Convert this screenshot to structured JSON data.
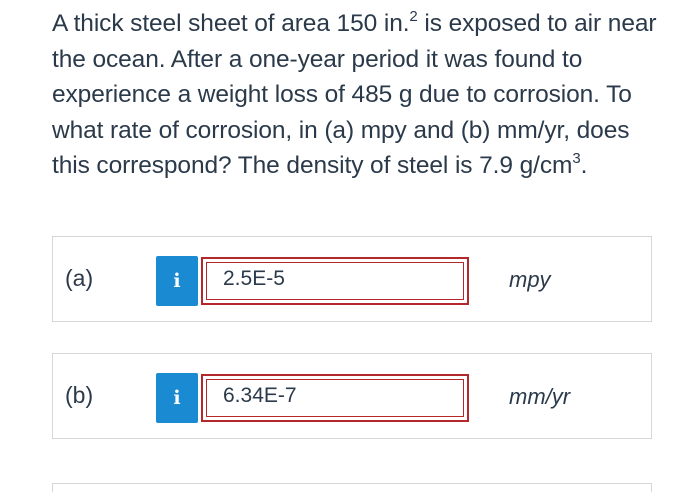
{
  "question": {
    "text_before_sup1": "A thick steel sheet of area 150 in.",
    "sup1": "2",
    "text_middle": " is exposed to air near the ocean. After a one-year period it was found to experience a weight loss of 485 g due to corrosion. To what rate of corrosion, in (a) mpy and (b) mm/yr, does this correspond? The density of steel is 7.9 g/cm",
    "sup2": "3",
    "text_end": "."
  },
  "answers": [
    {
      "label": "(a)",
      "info_icon": "i",
      "value": "2.5E-5",
      "unit": "mpy"
    },
    {
      "label": "(b)",
      "info_icon": "i",
      "value": "6.34E-7",
      "unit": "mm/yr"
    }
  ],
  "colors": {
    "info_button": "#1a8ad3",
    "input_border_error": "#b3282d",
    "text": "#2b3a4a",
    "row_border": "#d6d6d6"
  }
}
